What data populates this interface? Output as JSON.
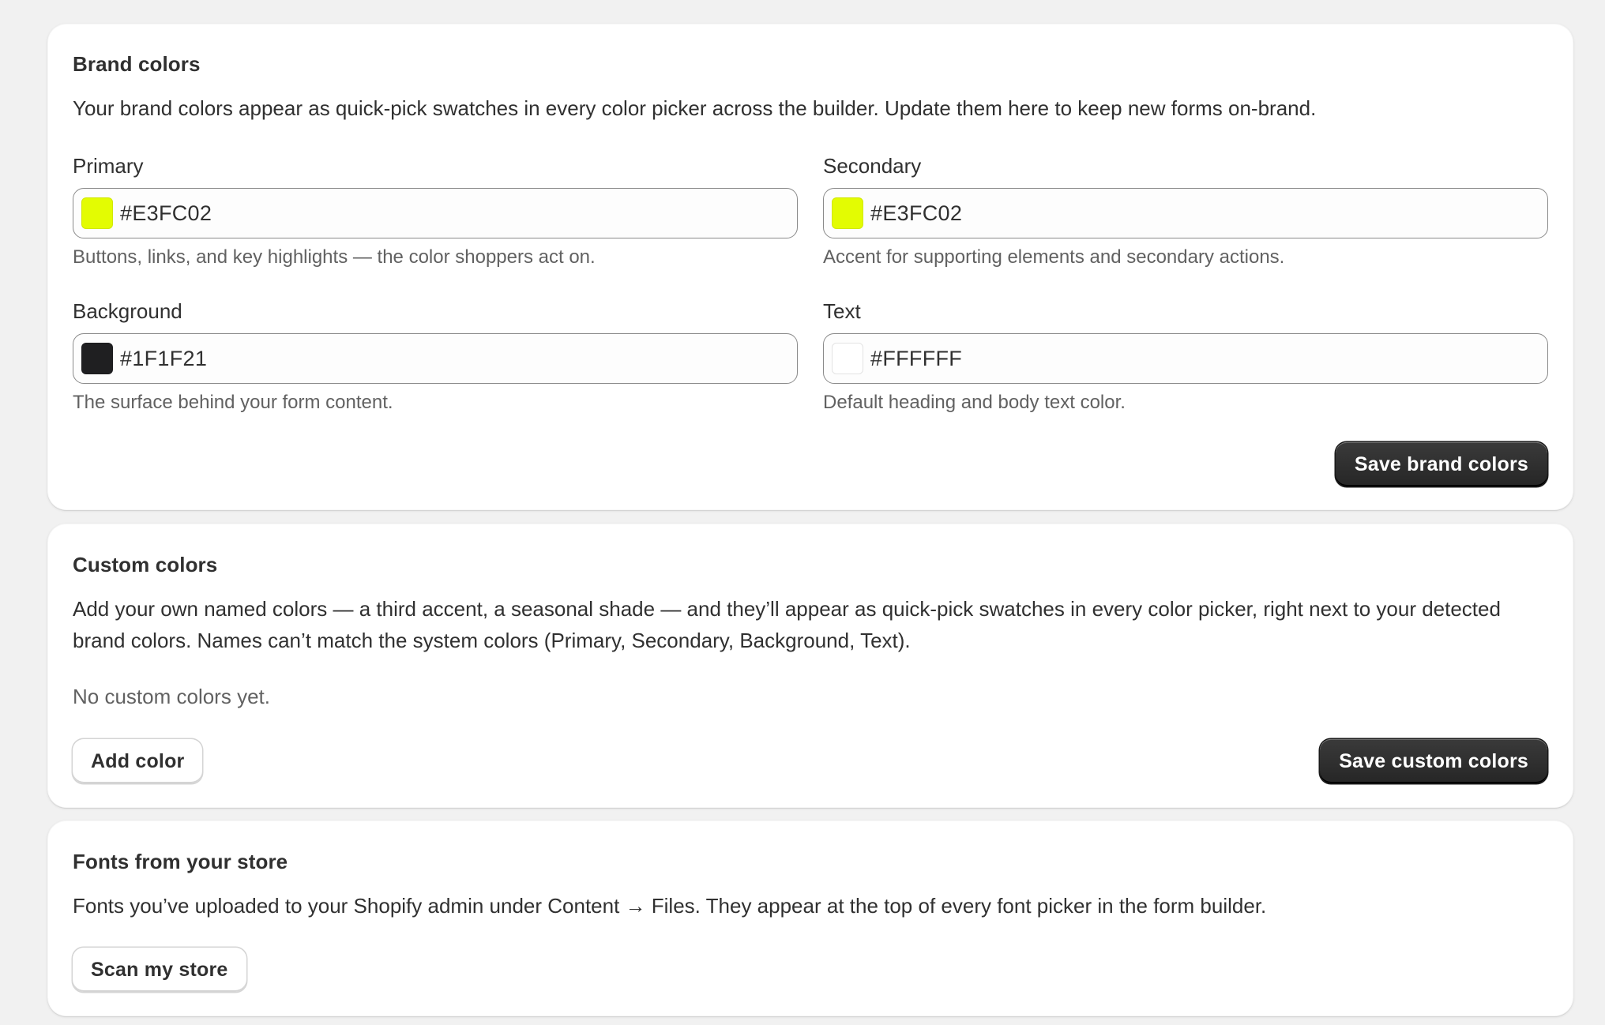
{
  "brand": {
    "title": "Brand colors",
    "description": "Your brand colors appear as quick-pick swatches in every color picker across the builder. Update them here to keep new forms on-brand.",
    "fields": {
      "primary": {
        "label": "Primary",
        "value": "#E3FC02",
        "help": "Buttons, links, and key highlights — the color shoppers act on.",
        "swatch": "#E3FC02"
      },
      "secondary": {
        "label": "Secondary",
        "value": "#E3FC02",
        "help": "Accent for supporting elements and secondary actions.",
        "swatch": "#E3FC02"
      },
      "background": {
        "label": "Background",
        "value": "#1F1F21",
        "help": "The surface behind your form content.",
        "swatch": "#1F1F21"
      },
      "text": {
        "label": "Text",
        "value": "#FFFFFF",
        "help": "Default heading and body text color.",
        "swatch": "#FFFFFF"
      }
    },
    "save_label": "Save brand colors"
  },
  "custom": {
    "title": "Custom colors",
    "description": "Add your own named colors — a third accent, a seasonal shade — and they’ll appear as quick-pick swatches in every color picker, right next to your detected brand colors. Names can’t match the system colors (Primary, Secondary, Background, Text).",
    "empty_text": "No custom colors yet.",
    "add_label": "Add color",
    "save_label": "Save custom colors"
  },
  "fonts": {
    "title": "Fonts from your store",
    "description": "Fonts you’ve uploaded to your Shopify admin under Content → Files. They appear at the top of every font picker in the form builder.",
    "scan_label": "Scan my store"
  },
  "colors": {
    "page_background": "#F1F1F1",
    "card_background": "#FFFFFF",
    "primary_button": "#303030",
    "text": "#303030",
    "muted_text": "#616161"
  }
}
